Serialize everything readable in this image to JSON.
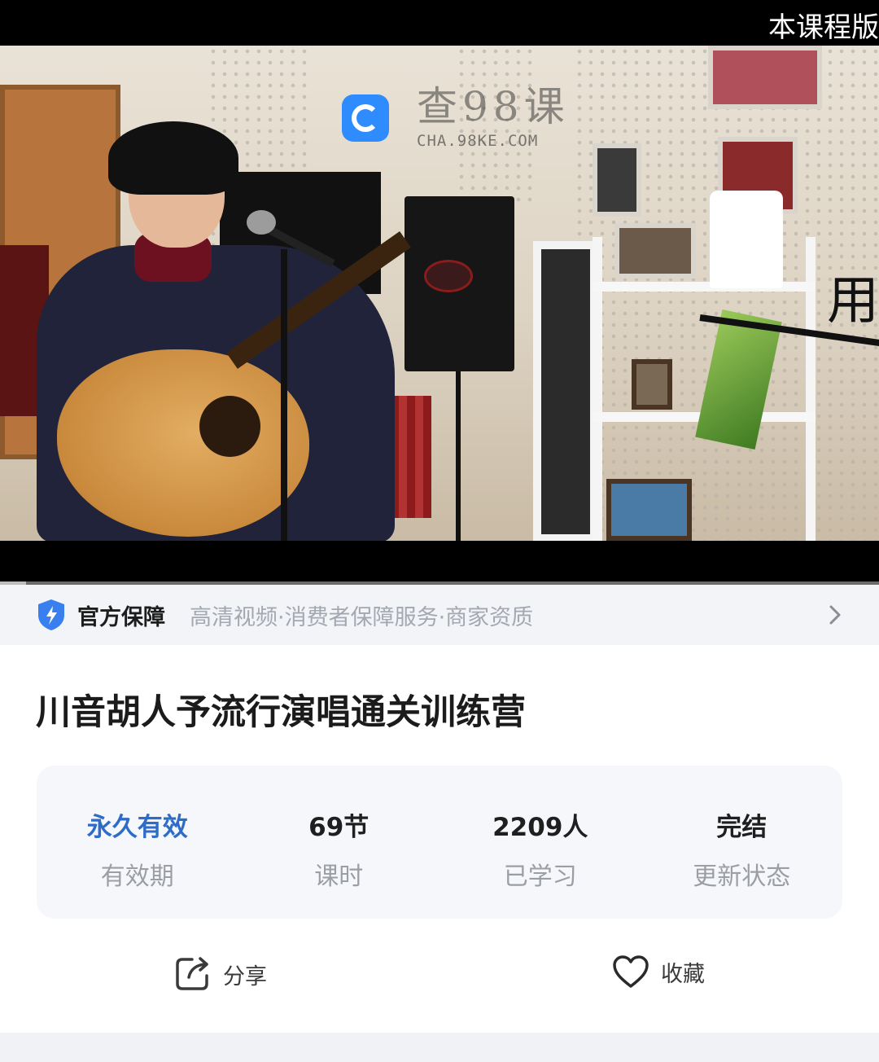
{
  "video": {
    "marquee_text": "本课程版",
    "side_text": "用",
    "watermark": {
      "main": "查98课",
      "sub": "CHA.98KE.COM"
    },
    "progress_fraction": 0.03
  },
  "guarantee": {
    "title": "官方保障",
    "items": "高清视频·消费者保障服务·商家资质",
    "icon": "shield-icon",
    "chevron": "chevron-right-icon",
    "accent_color": "#3a7ff0"
  },
  "course": {
    "title": "川音胡人予流行演唱通关训练营"
  },
  "stats": [
    {
      "value": "永久有效",
      "label": "有效期",
      "accent": true
    },
    {
      "value": "69节",
      "label": "课时",
      "accent": false
    },
    {
      "value": "2209人",
      "label": "已学习",
      "accent": false
    },
    {
      "value": "完结",
      "label": "更新状态",
      "accent": false
    }
  ],
  "actions": {
    "share_label": "分享",
    "share_icon": "share-icon",
    "favorite_label": "收藏",
    "favorite_icon": "heart-icon"
  },
  "colors": {
    "accent_blue": "#2f6cc8",
    "muted_text": "#9b9ea4",
    "card_bg": "#f5f7fb"
  }
}
